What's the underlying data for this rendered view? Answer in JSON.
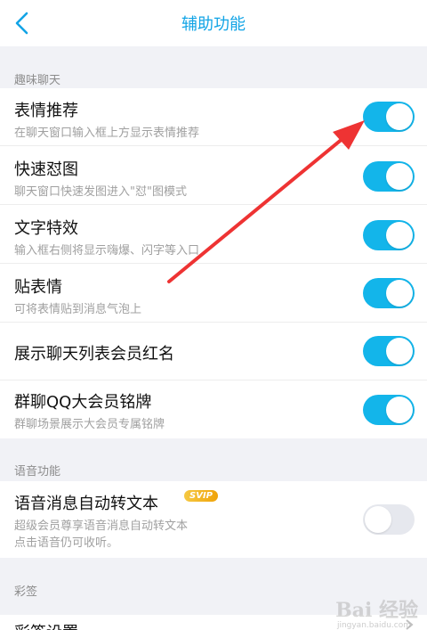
{
  "header": {
    "title": "辅助功能"
  },
  "sections": {
    "fun_chat": "趣味聊天",
    "voice": "语音功能",
    "signature": "彩签"
  },
  "items": [
    {
      "label": "表情推荐",
      "sub": "在聊天窗口输入框上方显示表情推荐",
      "enabled": true
    },
    {
      "label": "快速怼图",
      "sub": "聊天窗口快速发图进入\"怼\"图模式",
      "enabled": true
    },
    {
      "label": "文字特效",
      "sub": "输入框右侧将显示嗨爆、闪字等入口",
      "enabled": true
    },
    {
      "label": "贴表情",
      "sub": "可将表情贴到消息气泡上",
      "enabled": true
    },
    {
      "label": "展示聊天列表会员红名",
      "enabled": true
    },
    {
      "label": "群聊QQ大会员铭牌",
      "sub": "群聊场景展示大会员专属铭牌",
      "enabled": true
    }
  ],
  "voice_item": {
    "label": "语音消息自动转文本",
    "badge": "SVIP",
    "sub_line1": "超级会员尊享语音消息自动转文本",
    "sub_line2": "点击语音仍可收听。",
    "enabled": false
  },
  "signature_item": {
    "label": "彩签设置"
  },
  "watermark": {
    "brand": "Bai 经验",
    "url": "jingyan.baidu.com"
  },
  "colors": {
    "accent": "#13b5ea",
    "title": "#12a4e6",
    "annotation_arrow": "#ee3333"
  }
}
